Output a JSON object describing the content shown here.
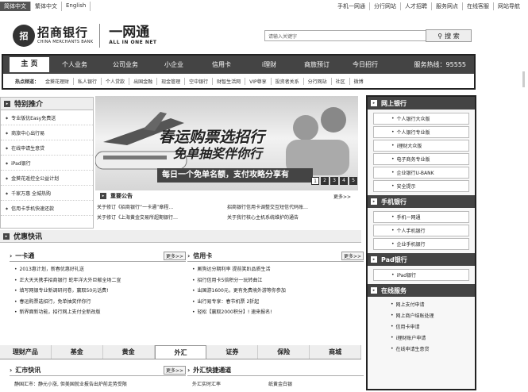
{
  "lang": {
    "items": [
      "简体中文",
      "繁体中文",
      "English"
    ]
  },
  "toplinks": [
    "手机一网通",
    "分行网站",
    "人才招聘",
    "服务网点",
    "在线客服",
    "网站导航"
  ],
  "logo": {
    "cn": "招商银行",
    "en": "CHINA MERCHANTS BANK",
    "cn2": "一网通",
    "en2": "ALL IN ONE NET"
  },
  "search": {
    "placeholder": "请输入关键字",
    "button": "搜 索"
  },
  "nav": {
    "items": [
      "主 页",
      "个人业务",
      "公司业务",
      "小企业",
      "信用卡",
      "i理财",
      "商旅预订",
      "今日招行"
    ],
    "hotline": "服务热线：95555",
    "hot_label": "热点频道：",
    "hot": [
      "金葵花理财",
      "私人银行",
      "个人贷款",
      "出国金融",
      "现金管理",
      "空中银行",
      "财智生活网",
      "VIP尊享",
      "投资者关系",
      "分行网站",
      "社区",
      "微博"
    ]
  },
  "featured": {
    "title": "特别推介",
    "items": [
      "专业版优Easy免费送",
      "商旅中心出行易",
      "在线申请生意贷",
      "iPad银行",
      "金葵花遥控全公益计划",
      "千家万惠 全城热购",
      "信用卡手机快速还款"
    ]
  },
  "banner": {
    "line1": "春运购票选招行",
    "line2": "免单抽奖伴你行",
    "strip": "每日一个免单名额，支付攻略分享有",
    "nums": [
      "1",
      "2",
      "3",
      "4",
      "5"
    ]
  },
  "notice": {
    "title": "重要公告",
    "more": "更多>>",
    "items": [
      "关于修订《招商银行“一卡通”章程…",
      "招商银行信用卡调整交互短信代码账…",
      "关于修订《上海黄金交易所超期银行…",
      "关于我行核心主机系统维护的通告"
    ]
  },
  "quick": {
    "title": "优惠快讯"
  },
  "col1": {
    "title": "一卡通",
    "more": "更多>>",
    "items": [
      "2013惠计划，新春优惠好礼送",
      "正大天天携手招商银行 蛇年洋大外巨献全场二宣",
      "填写网银专业新调研问卷，赢取50元话费!",
      "春运购票选招行，免单抽奖伴你行",
      "新界面新功能，招行网上支付全新改版"
    ]
  },
  "col2": {
    "title": "信用卡",
    "more": "更多>>",
    "items": [
      "厮狗达分期利率 提前笑趴品质生活",
      "招行信用卡5倍积分一玩转曲江",
      "出国游1600元，更有免费境外游等你参加",
      "出行易专享：春节机票 2折起",
      "轻松【赢取2000积分】! 速来报名!"
    ]
  },
  "tabs": {
    "items": [
      "理财产品",
      "基金",
      "黄金",
      "外汇",
      "证券",
      "保险",
      "商城"
    ]
  },
  "fx": {
    "title": "汇市快讯",
    "more": "更多>>",
    "item": "静国汇市：静元小涨, 但美国就业报告出炉前走势受限"
  },
  "fxch": {
    "title": "外汇快捷通道",
    "items": [
      "外汇实时汇率",
      "纸黄金白银"
    ]
  },
  "side": {
    "online": {
      "title": "网上银行",
      "items": [
        "个人银行大众版",
        "个人银行专业版",
        "i理财大众版",
        "电子商务专业版",
        "企业银行U-BANK",
        "安全提示"
      ]
    },
    "mobile": {
      "title": "手机银行",
      "items": [
        "手机一网通",
        "个人手机银行",
        "企业手机银行"
      ]
    },
    "pad": {
      "title": "Pad银行",
      "items": [
        "iPad银行"
      ]
    },
    "service": {
      "title": "在线服务",
      "items": [
        "网上支付申请",
        "网上商户结账处理",
        "信用卡申请",
        "i理财账户申请",
        "在线申请生意贷"
      ]
    }
  }
}
